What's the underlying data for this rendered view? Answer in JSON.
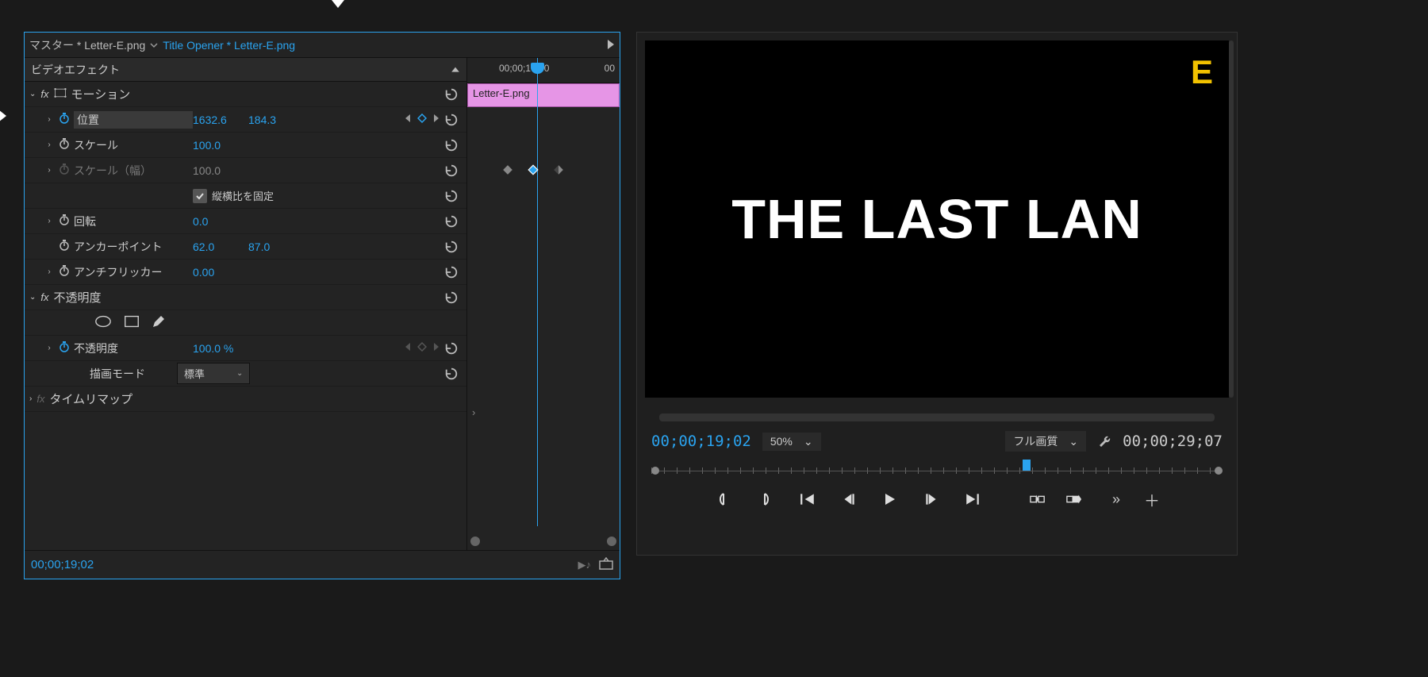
{
  "header": {
    "master_label": "マスター * Letter-E.png",
    "sequence_label": "Title Opener * Letter-E.png"
  },
  "sections": {
    "video_effects": "ビデオエフェクト"
  },
  "motion": {
    "group": "モーション",
    "position": {
      "label": "位置",
      "x": "1632.6",
      "y": "184.3"
    },
    "scale": {
      "label": "スケール",
      "value": "100.0"
    },
    "scale_w": {
      "label": "スケール（幅）",
      "value": "100.0"
    },
    "lock_aspect": "縦横比を固定",
    "rotation": {
      "label": "回転",
      "value": "0.0"
    },
    "anchor": {
      "label": "アンカーポイント",
      "x": "62.0",
      "y": "87.0"
    },
    "antiflicker": {
      "label": "アンチフリッカー",
      "value": "0.00"
    }
  },
  "opacity": {
    "group": "不透明度",
    "opacity": {
      "label": "不透明度",
      "value": "100.0 %"
    },
    "blend": {
      "label": "描画モード",
      "value": "標準"
    }
  },
  "timeremap": {
    "group": "タイムリマップ"
  },
  "footer": {
    "timecode": "00;00;19;02"
  },
  "timeline": {
    "ruler_mid": "00;00;16;00",
    "ruler_end": "00",
    "clip_label": "Letter-E.png"
  },
  "monitor": {
    "title_text": "THE LAST LAN",
    "letter": "E",
    "tc_current": "00;00;19;02",
    "zoom": "50%",
    "quality": "フル画質",
    "tc_duration": "00;00;29;07"
  }
}
